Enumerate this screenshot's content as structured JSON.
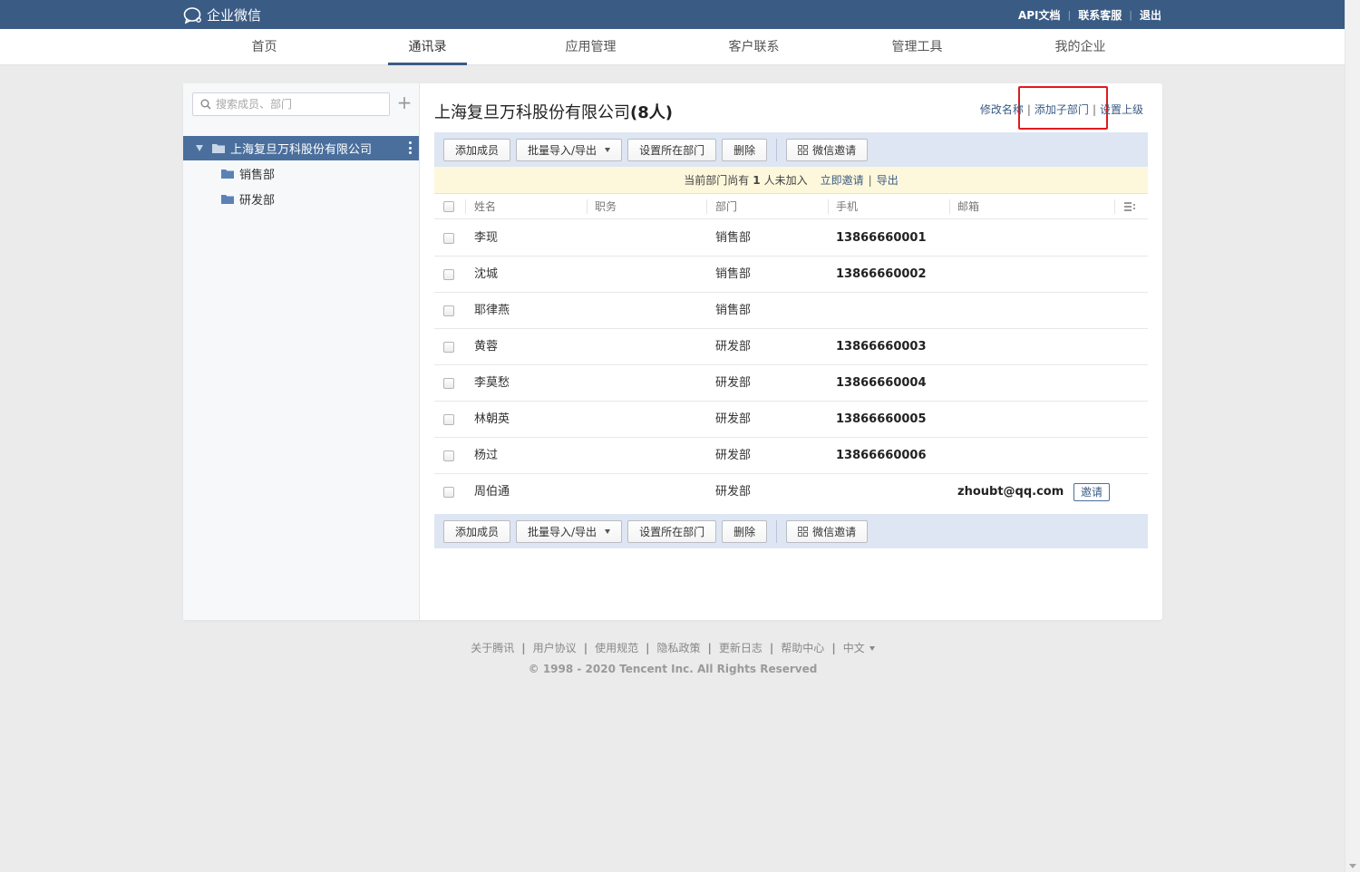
{
  "header": {
    "app_name": "企业微信",
    "links": [
      "API文档",
      "联系客服",
      "退出"
    ]
  },
  "nav": {
    "items": [
      "首页",
      "通讯录",
      "应用管理",
      "客户联系",
      "管理工具",
      "我的企业"
    ],
    "active": "通讯录"
  },
  "sidebar": {
    "search_placeholder": "搜索成员、部门",
    "root": "上海复旦万科股份有限公司",
    "children": [
      "销售部",
      "研发部"
    ]
  },
  "content": {
    "company": "上海复旦万科股份有限公司",
    "count": "(8人)",
    "actions": [
      "修改名称",
      "添加子部门",
      "设置上级"
    ],
    "toolbar": {
      "add_member": "添加成员",
      "batch": "批量导入/导出",
      "set_dept": "设置所在部门",
      "delete": "删除",
      "wechat_invite": "微信邀请"
    },
    "notice": {
      "prefix": "当前部门尚有",
      "count": "1",
      "suffix": "人未加入",
      "invite_link": "立即邀请",
      "export_link": "导出"
    },
    "columns": [
      "姓名",
      "职务",
      "部门",
      "手机",
      "邮箱"
    ],
    "rows": [
      {
        "name": "李现",
        "title": "",
        "dept": "销售部",
        "phone": "13866660001",
        "email": ""
      },
      {
        "name": "沈城",
        "title": "",
        "dept": "销售部",
        "phone": "13866660002",
        "email": ""
      },
      {
        "name": "耶律燕",
        "title": "",
        "dept": "销售部",
        "phone": "",
        "email": ""
      },
      {
        "name": "黄蓉",
        "title": "",
        "dept": "研发部",
        "phone": "13866660003",
        "email": ""
      },
      {
        "name": "李莫愁",
        "title": "",
        "dept": "研发部",
        "phone": "13866660004",
        "email": ""
      },
      {
        "name": "林朝英",
        "title": "",
        "dept": "研发部",
        "phone": "13866660005",
        "email": ""
      },
      {
        "name": "杨过",
        "title": "",
        "dept": "研发部",
        "phone": "13866660006",
        "email": ""
      },
      {
        "name": "周伯通",
        "title": "",
        "dept": "研发部",
        "phone": "",
        "email": "zhoubt@qq.com",
        "invite": "邀请"
      }
    ]
  },
  "footer": {
    "links": [
      "关于腾讯",
      "用户协议",
      "使用规范",
      "隐私政策",
      "更新日志",
      "帮助中心"
    ],
    "language": "中文",
    "copyright": "© 1998 - 2020 Tencent Inc. All Rights Reserved"
  },
  "colors": {
    "header_bg": "#3a5b84",
    "selected_dept_bg": "#4a6f9d",
    "toolbar_bg": "#dde6f2",
    "notice_bg": "#fdf8dc",
    "highlight_border": "#e0191e"
  }
}
